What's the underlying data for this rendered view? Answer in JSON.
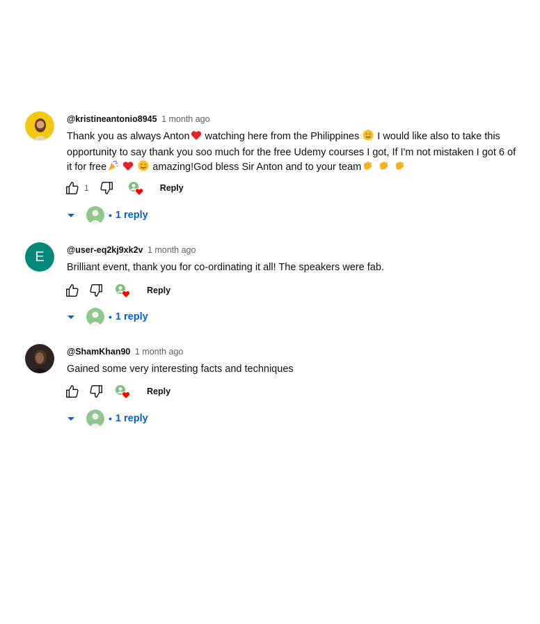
{
  "comments": [
    {
      "author": "@kristineantonio8945",
      "time": "1 month ago",
      "avatar": "photo-avatar",
      "text_parts": [
        "Thank you as always Anton",
        " watching here from the Philippines ",
        " I would like also to take this opportunity to say thank you soo much for the free Udemy courses I got,  If I'm not mistaken I got 6 of it for free",
        " ",
        " ",
        " amazing!God bless Sir Anton and to your team"
      ],
      "like_count": "1",
      "reply_label": "Reply",
      "replies_label": "1 reply"
    },
    {
      "author": "@user-eq2kj9xk2v",
      "time": "1 month ago",
      "avatar_letter": "E",
      "text": "Brilliant event, thank you for co-ordinating it all! The speakers were fab.",
      "like_count": "",
      "reply_label": "Reply",
      "replies_label": "1 reply"
    },
    {
      "author": "@ShamKhan90",
      "time": "1 month ago",
      "avatar": "photo-avatar",
      "text": "Gained some very interesting facts and techniques",
      "like_count": "",
      "reply_label": "Reply",
      "replies_label": "1 reply"
    }
  ],
  "replies_separator": "•",
  "colors": {
    "link_blue": "#065fd4",
    "secondary_text": "#606060",
    "heart_red": "#ff0000",
    "letter_avatar_bg": "#00897b"
  },
  "icons": [
    "thumbs-up-icon",
    "thumbs-down-icon",
    "creator-heart-icon",
    "caret-down-icon",
    "red-heart-emoji",
    "smile-emoji",
    "party-popper-emoji",
    "clapping-hands-emoji"
  ]
}
